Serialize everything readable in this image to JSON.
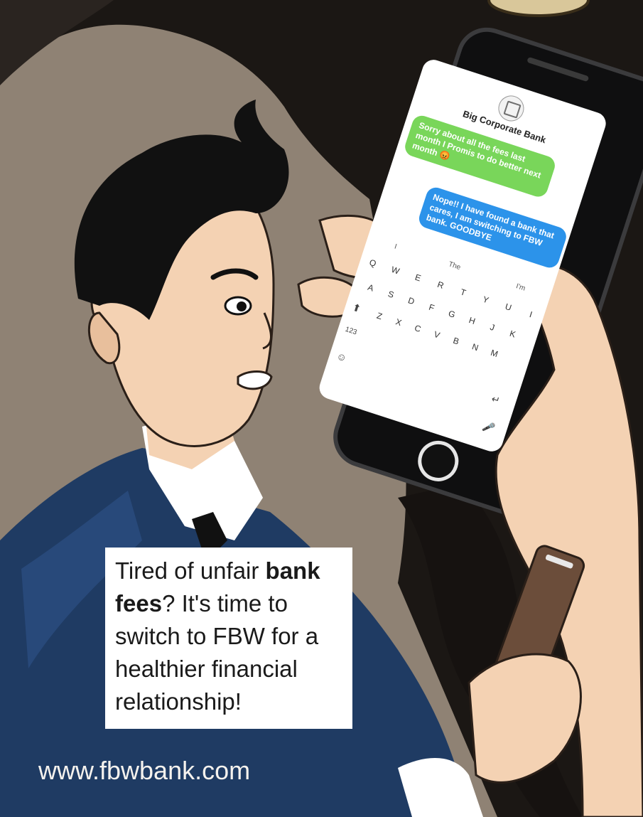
{
  "chat": {
    "contact_name": "Big Corporate Bank",
    "incoming": "Sorry about all the fees last month I Promis to do better next month 😡",
    "outgoing": "Nope!! I have found a bank that cares, I am switching to FBW bank. GOODBYE"
  },
  "keyboard": {
    "suggestions": [
      "I",
      "The",
      "I'm"
    ],
    "row1": [
      "Q",
      "W",
      "E",
      "R",
      "T",
      "Y",
      "U",
      "I"
    ],
    "row2": [
      "A",
      "S",
      "D",
      "F",
      "G",
      "H",
      "J",
      "K"
    ],
    "row3": [
      "Z",
      "X",
      "C",
      "V",
      "B",
      "N",
      "M"
    ],
    "numbers_key": "123"
  },
  "caption": {
    "line1_pre": "Tired of unfair ",
    "line1_bold": "bank",
    "line2_bold": "fees",
    "line2_post": "? It's time to",
    "line3": "switch to FBW for a",
    "line4": "healthier financial",
    "line5": "relationship!"
  },
  "website": "www.fbwbank.com",
  "colors": {
    "background": "#1b1714",
    "wall": "#8f8274",
    "skin": "#f4d2b3",
    "hair": "#111111",
    "suit": "#1f3b63",
    "bubble_green": "#79d65a",
    "bubble_blue": "#2c93ea",
    "phone_body": "#0f0f10"
  }
}
